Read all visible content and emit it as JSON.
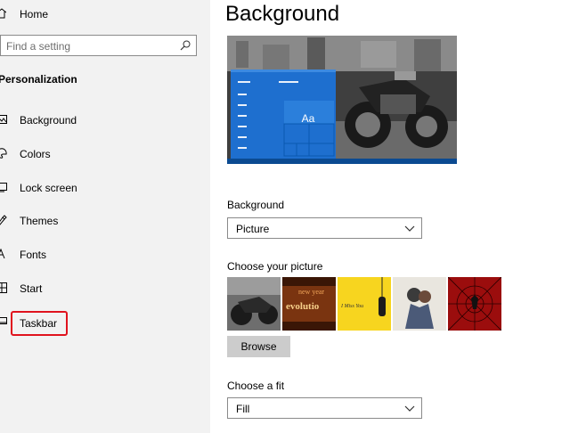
{
  "sidebar": {
    "home_label": "Home",
    "search_placeholder": "Find a setting",
    "section_title": "Personalization",
    "items": [
      {
        "label": "Background",
        "icon": "picture-icon"
      },
      {
        "label": "Colors",
        "icon": "palette-icon"
      },
      {
        "label": "Lock screen",
        "icon": "lock-screen-icon"
      },
      {
        "label": "Themes",
        "icon": "themes-icon"
      },
      {
        "label": "Fonts",
        "icon": "fonts-icon"
      },
      {
        "label": "Start",
        "icon": "start-icon"
      },
      {
        "label": "Taskbar",
        "icon": "taskbar-icon",
        "highlighted": true
      }
    ]
  },
  "main": {
    "title": "Background",
    "preview": {
      "sample_text": "Aa"
    },
    "background_label": "Background",
    "background_value": "Picture",
    "choose_picture_label": "Choose your picture",
    "thumbnails": [
      "motorcycle-thumbnail",
      "new-year-thumbnail",
      "yellow-phone-thumbnail",
      "couple-sketch-thumbnail",
      "spider-man-thumbnail"
    ],
    "thumbnail_texts": {
      "new_year_line1": "new year",
      "new_year_line2": "evolutio",
      "yellow_phone": "I Miss You"
    },
    "browse_label": "Browse",
    "choose_fit_label": "Choose a fit",
    "fit_value": "Fill"
  },
  "colors": {
    "accent": "#0078d7",
    "highlight_border": "#e0131e",
    "sidebar_bg": "#f2f2f2"
  }
}
